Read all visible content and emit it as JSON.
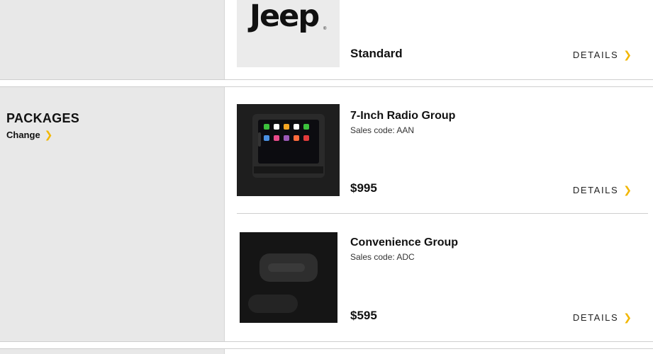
{
  "standard_section": {
    "brand": "Jeep",
    "label": "Standard",
    "details_label": "DETAILS"
  },
  "packages": {
    "title": "PACKAGES",
    "change_label": "Change",
    "items": [
      {
        "name": "7-Inch Radio Group",
        "sales_code": "Sales code: AAN",
        "price": "$995",
        "details_label": "DETAILS"
      },
      {
        "name": "Convenience Group",
        "sales_code": "Sales code: ADC",
        "price": "$595",
        "details_label": "DETAILS"
      }
    ]
  },
  "colors": {
    "accent": "#f2b705",
    "left_panel_bg": "#e8e8e8"
  },
  "icons": {
    "chevron": "chevron-right-icon"
  }
}
